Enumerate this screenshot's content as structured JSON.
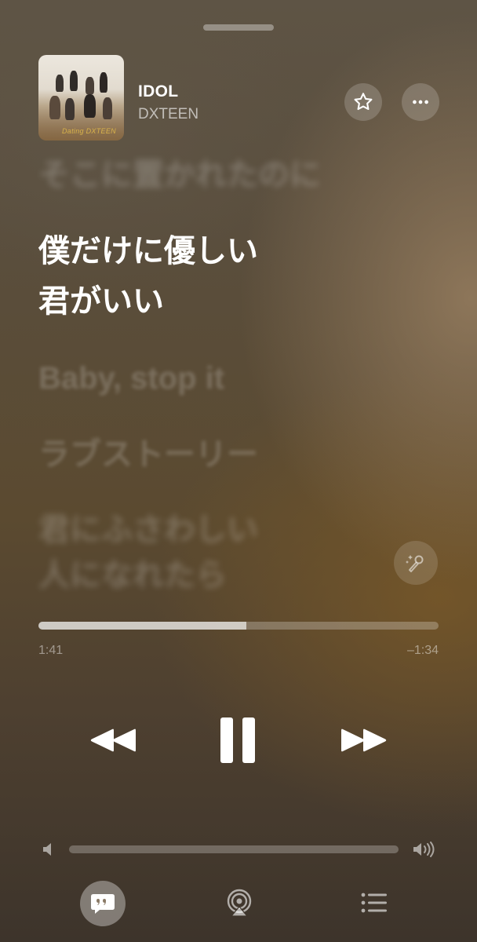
{
  "now_playing": {
    "title": "IDOL",
    "artist": "DXTEEN",
    "artwork_caption": "Dating DXTEEN"
  },
  "lyrics": {
    "previous": "そこに置かれたのに",
    "current_line1": "僕だけに優しい",
    "current_line2": "君がいい",
    "next1": "Baby, stop it",
    "next2": "ラブストーリー",
    "next3_line1": "君にふさわしい",
    "next3_line2": "人になれたら"
  },
  "playback": {
    "elapsed": "1:41",
    "remaining": "–1:34",
    "progress_fraction": 0.52
  },
  "volume": {
    "level_fraction": 0.0
  },
  "icons": {
    "favorite": "star-icon",
    "more": "ellipsis-icon",
    "sing": "microphone-sparkle-icon",
    "rewind": "rewind-icon",
    "pause": "pause-icon",
    "forward": "fast-forward-icon",
    "volume_low": "speaker-icon",
    "volume_high": "speaker-wave-icon",
    "lyrics": "lyrics-quote-icon",
    "airplay": "airplay-icon",
    "queue": "queue-list-icon"
  }
}
